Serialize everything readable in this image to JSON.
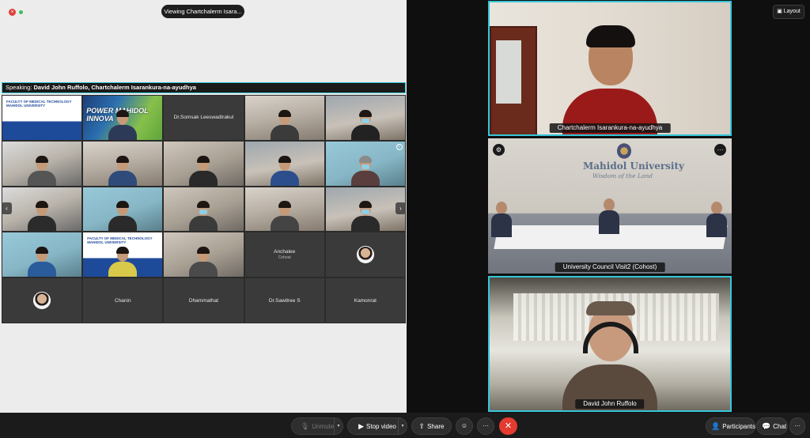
{
  "window": {
    "close_glyph": "×",
    "viewing_text": "Viewing Chartchalerm Isara..."
  },
  "speaking": {
    "prefix": "Speaking:",
    "names": "David John Ruffolo, Chartchalerm Isarankura-na-ayudhya"
  },
  "grid": {
    "slide_text": "FACULTY OF MEDICAL TECHNOLOGY MAHIDOL UNIVERSITY",
    "poster_text": "POWER MAHIDOL INNOVA",
    "named_tiles": {
      "somsak": "Dr.Somsak Leeswadtrakul",
      "anchalee": "Anchalee",
      "anchalee_role": "Cohost",
      "chanin": "Chanin",
      "dhammathat": "Dhammathat",
      "sawitree": "Dr.Sawitree S",
      "kamonrat": "Kamonrat"
    },
    "prev_arrow": "‹",
    "next_arrow": "›"
  },
  "stage": {
    "layout_label": "Layout",
    "feeds": [
      {
        "name": "Chartchalerm Isarankura-na-ayudhya"
      },
      {
        "name": "University Council Visit2  (Cohost)",
        "logo": "Mahidol University",
        "motto": "Wisdom of the Land"
      },
      {
        "name": "David John Ruffolo"
      }
    ],
    "menu_glyph": "···",
    "tools_glyph": "⚙"
  },
  "toolbar": {
    "unmute_label": "Unmute",
    "stop_video_label": "Stop video",
    "share_label": "Share",
    "reactions_glyph": "☺",
    "more_glyph": "···",
    "end_glyph": "✕",
    "participants_label": "Participants",
    "chat_label": "Chat",
    "overflow_glyph": "···"
  },
  "colors": {
    "accent": "#36c6d8",
    "end_call": "#e33b2f",
    "background": "#1b1b1b"
  },
  "icons": [
    "close-icon",
    "mic-icon",
    "camera-icon",
    "share-icon",
    "reaction-icon",
    "more-icon",
    "end-call-icon",
    "participants-icon",
    "chat-icon",
    "layout-icon",
    "gear-icon"
  ]
}
